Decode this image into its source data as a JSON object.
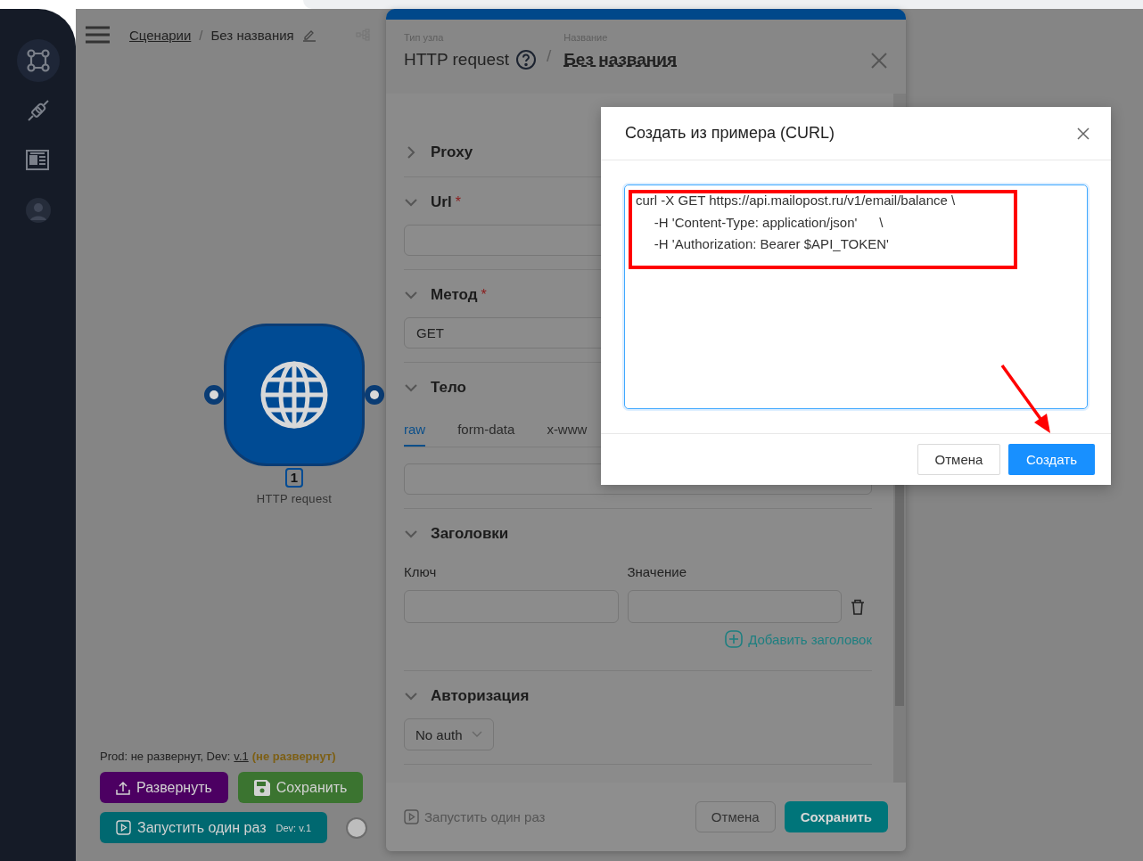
{
  "sidebar": {
    "items": [
      {
        "kind": "graph",
        "selected": true
      },
      {
        "kind": "plug",
        "selected": false
      },
      {
        "kind": "news",
        "selected": false
      },
      {
        "kind": "user",
        "selected": false
      }
    ]
  },
  "breadcrumb": {
    "link": "Сценарии",
    "separator": "/",
    "current": "Без названия"
  },
  "node": {
    "badge": "1",
    "label": "HTTP request"
  },
  "deploy_status": {
    "prefix": "Prod: не развернут, Dev:",
    "version": "v.1",
    "state": "(не развернут)"
  },
  "actions": {
    "deploy": "Развернуть",
    "save": "Сохранить",
    "run": "Запустить один раз",
    "run_version": "Dev: v.1",
    "auto_toggle_on": false
  },
  "panel": {
    "type_label": "Тип узла",
    "type": "HTTP request",
    "name_label": "Название",
    "separator": "/",
    "name": "Без названия",
    "sections": [
      {
        "title": "Proxy",
        "expanded": false
      },
      {
        "kind": "input",
        "title": "Url",
        "required_mark": "*",
        "expanded": true
      },
      {
        "kind": "select",
        "title": "Метод",
        "required_mark": "*",
        "expanded": true,
        "value": "GET"
      },
      {
        "kind": "body",
        "title": "Тело",
        "expanded": true,
        "tabs": [
          {
            "label": "raw",
            "selected": true
          },
          {
            "label": "form-data",
            "selected": false
          },
          {
            "label": "x-www",
            "selected": false
          }
        ]
      },
      {
        "kind": "headers",
        "title": "Заголовки",
        "expanded": true,
        "key_label": "Ключ",
        "value_label": "Значение",
        "add_label": "Добавить заголовок"
      },
      {
        "kind": "dropdown",
        "title": "Авторизация",
        "expanded": true,
        "value": "No auth"
      }
    ],
    "footer": {
      "run": "Запустить один раз",
      "cancel": "Отмена",
      "save": "Сохранить"
    }
  },
  "modal": {
    "title": "Создать из примера (CURL)",
    "curl": "curl -X GET https://api.mailopost.ru/v1/email/balance \\\n     -H 'Content-Type: application/json'      \\\n     -H 'Authorization: Bearer $API_TOKEN'",
    "cancel": "Отмена",
    "create": "Создать"
  }
}
